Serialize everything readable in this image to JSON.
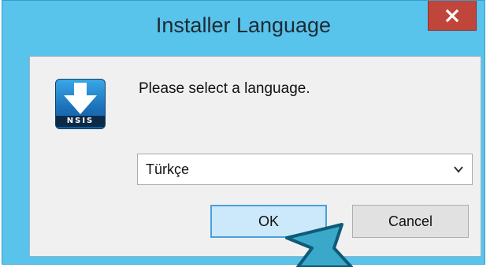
{
  "window": {
    "title": "Installer Language",
    "close_label": "x"
  },
  "dialog": {
    "icon_text": "NSIS",
    "prompt": "Please select a language.",
    "language_select": {
      "selected": "Türkçe"
    },
    "ok_label": "OK",
    "cancel_label": "Cancel"
  },
  "colors": {
    "frame": "#58c3eb",
    "close": "#c0453a",
    "ok_focus": "#cce8fb",
    "cursor": "#3aa9c9"
  }
}
